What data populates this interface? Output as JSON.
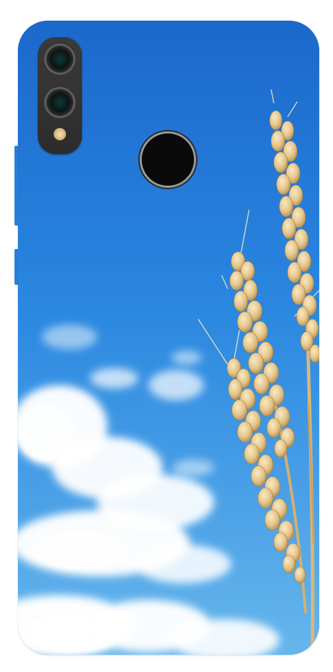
{
  "colors": {
    "sky_top": "#1f6fd0",
    "sky_mid": "#2a86e0",
    "sky_bottom": "#5aaee9",
    "cloud": "#ffffff",
    "wheat": "#e2c48a",
    "wheat_shadow": "#b78d4c",
    "camera_body": "#2c2c2c",
    "fingerprint": "#0a0a0a"
  },
  "icons": {
    "camera_lens_top": "camera-lens-icon",
    "camera_lens_bottom": "camera-lens-icon",
    "flash": "flash-icon",
    "fingerprint_sensor": "fingerprint-sensor-icon"
  }
}
